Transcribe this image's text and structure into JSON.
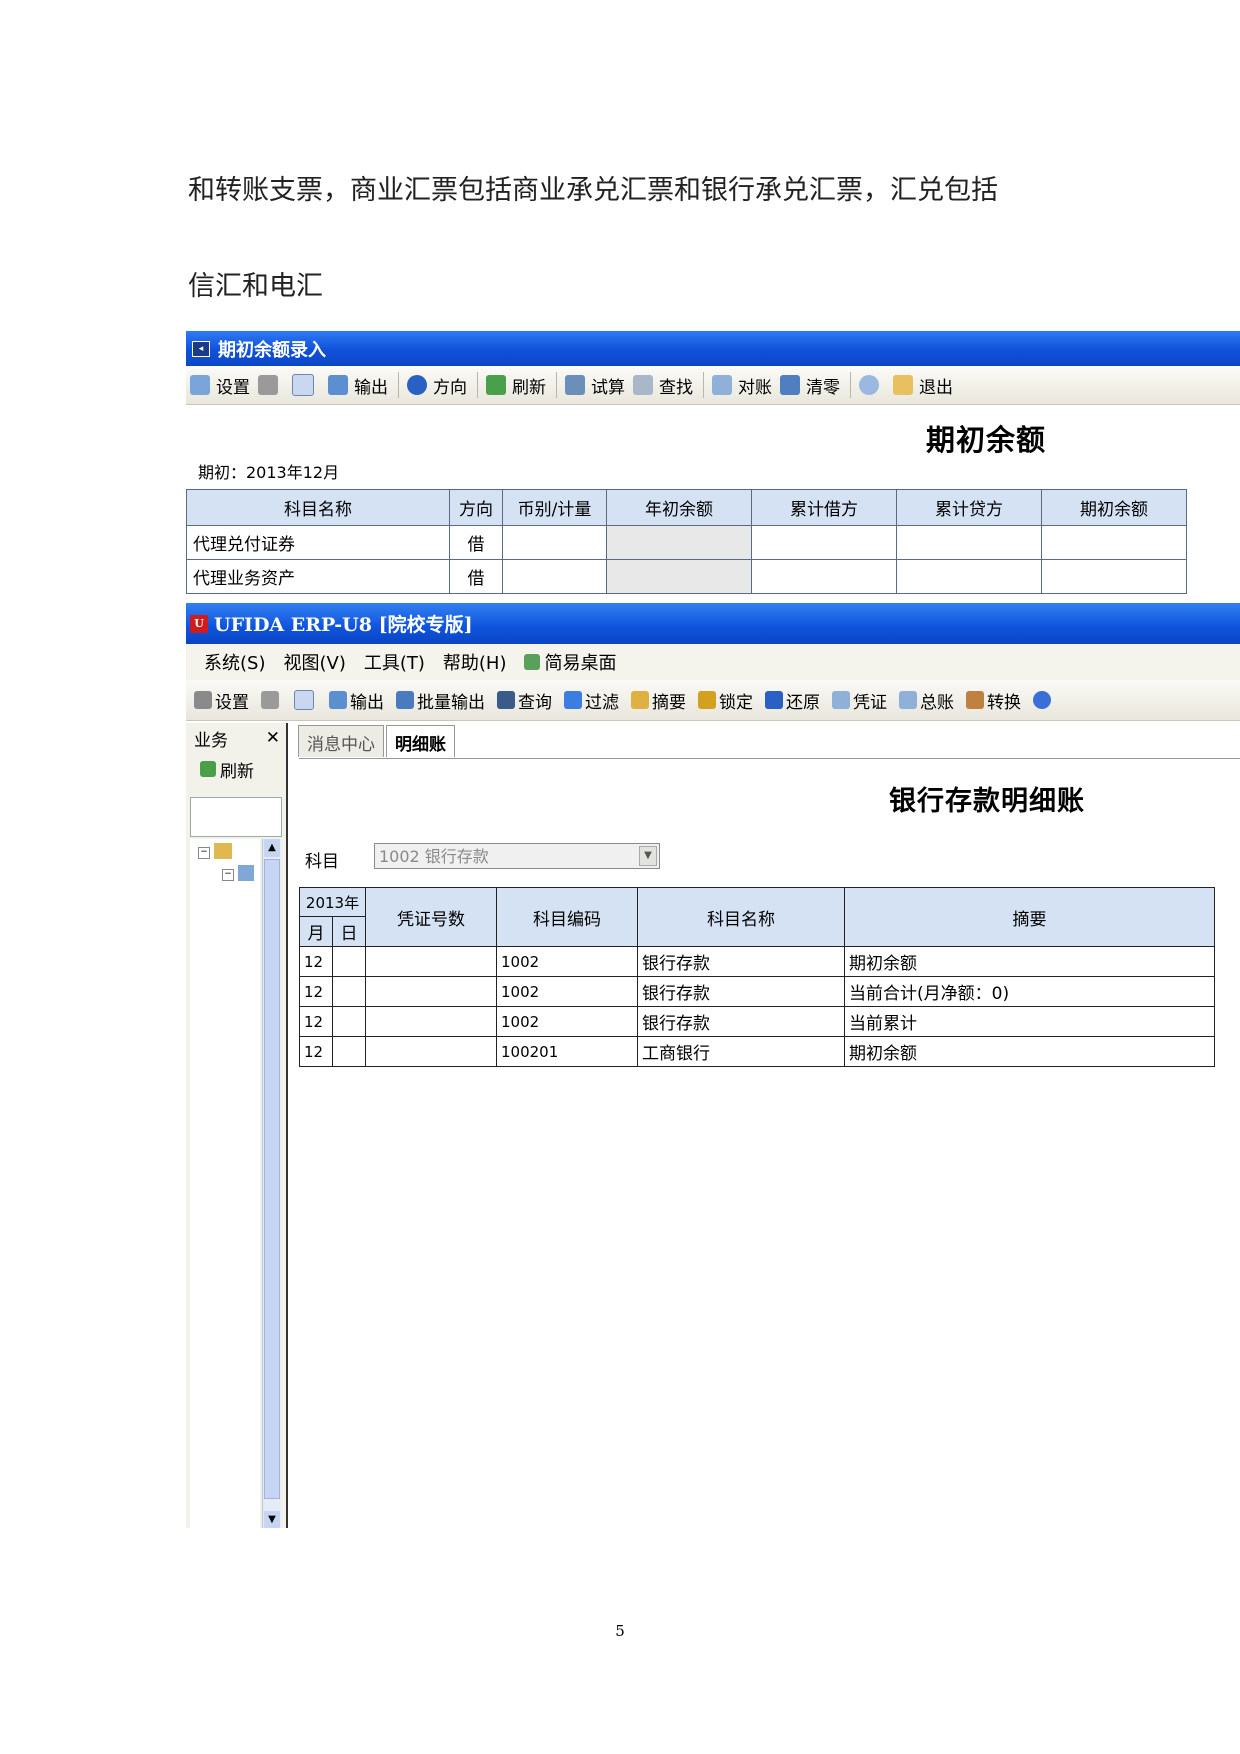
{
  "doc": {
    "line1": "和转账支票，商业汇票包括商业承兑汇票和银行承兑汇票，汇兑包括",
    "line2": "信汇和电汇",
    "page_number": "5"
  },
  "shot1": {
    "window_title": "期初余额录入",
    "toolbar": [
      "设置",
      "输出",
      "方向",
      "刷新",
      "试算",
      "查找",
      "对账",
      "清零",
      "退出"
    ],
    "heading": "期初余额",
    "period": "期初：2013年12月",
    "columns": [
      "科目名称",
      "方向",
      "币别/计量",
      "年初余额",
      "累计借方",
      "累计贷方",
      "期初余额"
    ],
    "rows": [
      {
        "name": "代理兑付证券",
        "dir": "借"
      },
      {
        "name": "代理业务资产",
        "dir": "借"
      }
    ]
  },
  "shot2": {
    "window_title": "UFIDA ERP-U8 [院校专版]",
    "menu": [
      "系统(S)",
      "视图(V)",
      "工具(T)",
      "帮助(H)",
      "简易桌面"
    ],
    "toolbar": [
      "设置",
      "输出",
      "批量输出",
      "查询",
      "过滤",
      "摘要",
      "锁定",
      "还原",
      "凭证",
      "总账",
      "转换"
    ],
    "left_panel": {
      "title": "业务",
      "refresh": "刷新"
    },
    "tabs": [
      "消息中心",
      "明细账"
    ],
    "heading": "银行存款明细账",
    "subject_label": "科目",
    "subject_value": "1002 银行存款",
    "year_header": "2013年",
    "month_header": "月",
    "day_header": "日",
    "columns": [
      "凭证号数",
      "科目编码",
      "科目名称",
      "摘要"
    ],
    "rows": [
      {
        "month": "12",
        "day": "",
        "voucher": "",
        "code": "1002",
        "name": "银行存款",
        "summary": "期初余额"
      },
      {
        "month": "12",
        "day": "",
        "voucher": "",
        "code": "1002",
        "name": "银行存款",
        "summary": "当前合计(月净额：0)"
      },
      {
        "month": "12",
        "day": "",
        "voucher": "",
        "code": "1002",
        "name": "银行存款",
        "summary": "当前累计"
      },
      {
        "month": "12",
        "day": "",
        "voucher": "",
        "code": "100201",
        "name": "工商银行",
        "summary": "期初余额"
      }
    ]
  }
}
